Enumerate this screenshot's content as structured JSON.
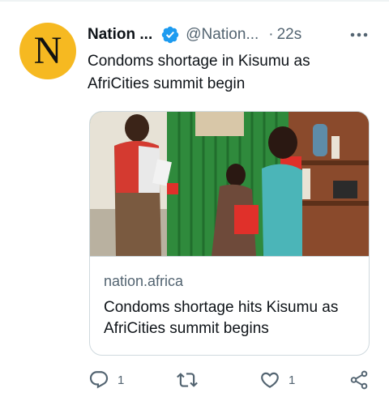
{
  "tweet": {
    "avatar_letter": "N",
    "author_name": "Nation ...",
    "handle": "@Nation...",
    "separator": "·",
    "timestamp": "22s",
    "text": "Condoms shortage in Kisumu as AfriCities summit begin"
  },
  "card": {
    "domain": "nation.africa",
    "title": "Condoms shortage hits Kisumu as AfriCities summit begins"
  },
  "actions": {
    "reply_count": "1",
    "like_count": "1"
  },
  "colors": {
    "avatar_bg": "#f6b921",
    "verified": "#1d9bf0",
    "secondary_text": "#536471",
    "border": "#cfd9de"
  },
  "icons": [
    "verified-badge-icon",
    "more-icon",
    "reply-icon",
    "retweet-icon",
    "like-icon",
    "share-icon"
  ]
}
